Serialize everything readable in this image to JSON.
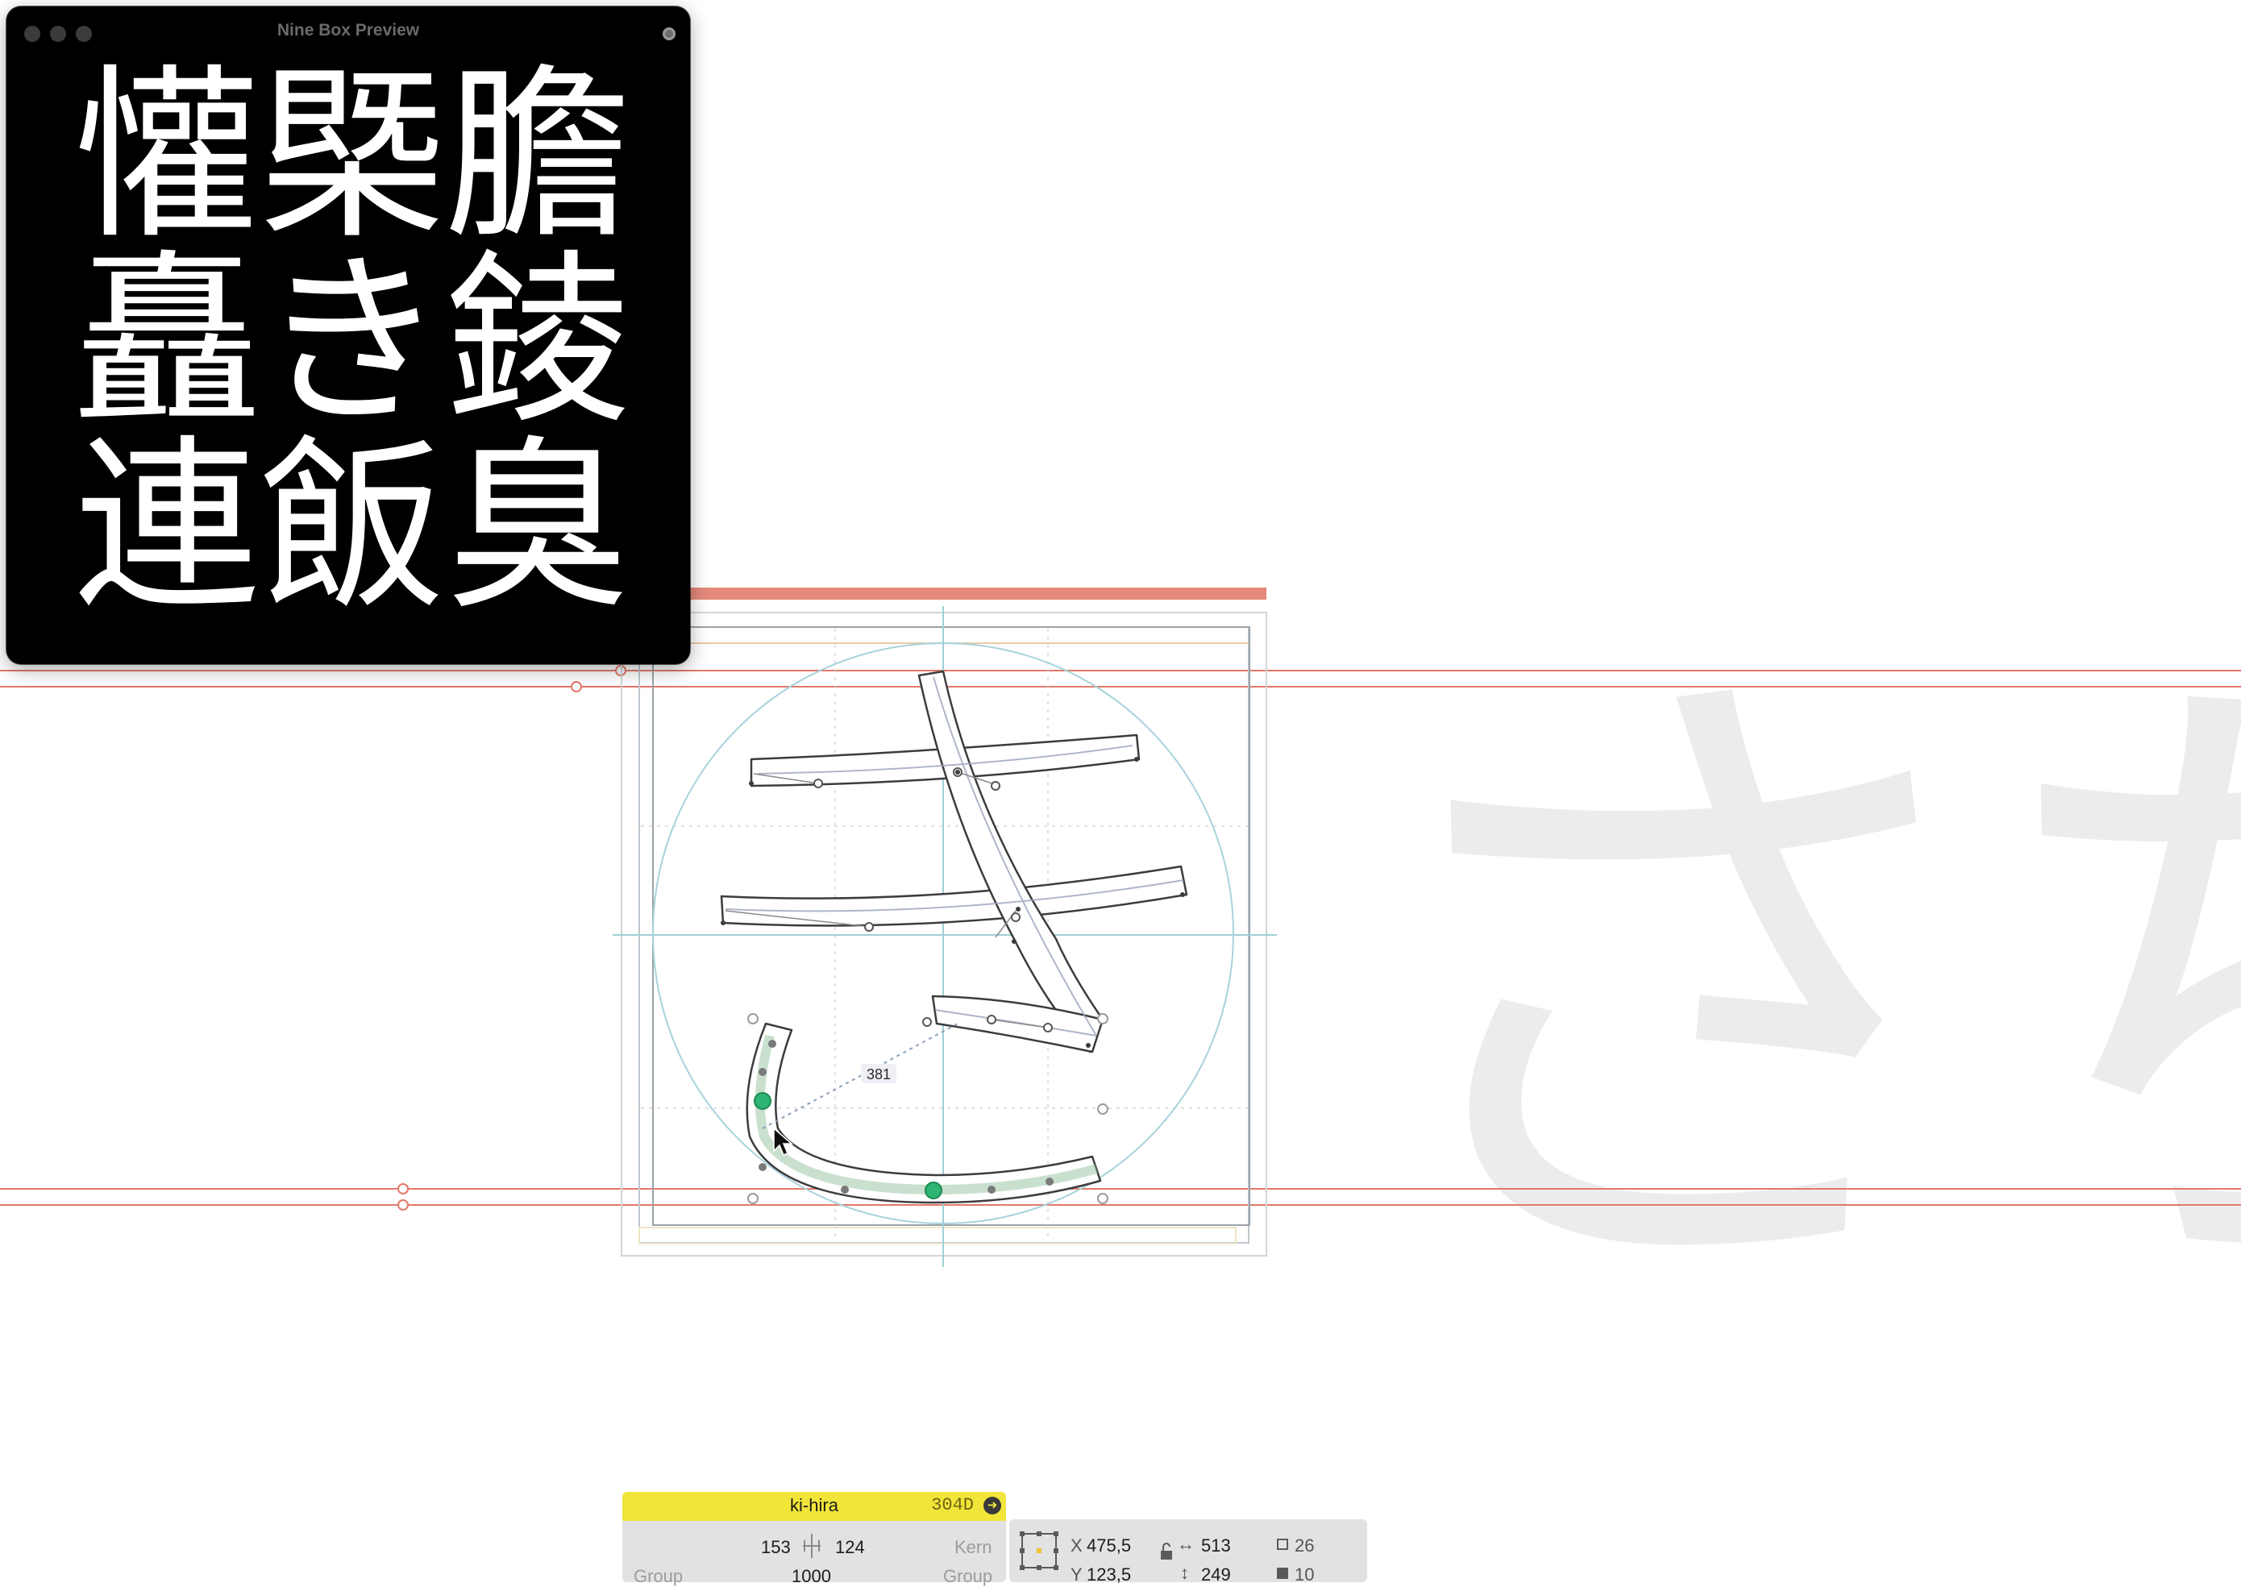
{
  "preview": {
    "title": "Nine Box Preview",
    "glyphs": [
      "懽",
      "槩",
      "膽",
      "矗",
      "き",
      "錂",
      "連",
      "飯",
      "臭"
    ]
  },
  "editor": {
    "measurement_label": "381",
    "background_glyphs": [
      "さ",
      "ち"
    ]
  },
  "info_bar": {
    "glyph_name": "ki-hira",
    "unicode": "304D",
    "left_sidebearing": "153",
    "right_sidebearing": "124",
    "width": "1000",
    "kern_label": "Kern",
    "group_left_label": "Group",
    "group_right_label": "Group",
    "x_label": "X",
    "x_value": "475,5",
    "y_label": "Y",
    "y_value": "123,5",
    "w_value": "513",
    "h_value": "249",
    "selected_points": "26",
    "selected_segments": "10"
  },
  "colors": {
    "guide_red": "#e2796a",
    "band_salmon": "#e48a7a",
    "outline": "#3c3c3c",
    "node_green": "#2fb573",
    "background_glyph": "#ececec",
    "info_yellow": "#f1e53a"
  }
}
